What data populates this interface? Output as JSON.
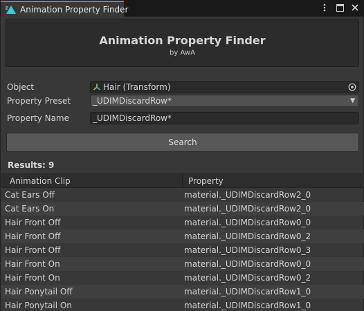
{
  "window": {
    "tab_title": "Animation Property Finder",
    "controls": [
      "more-options",
      "maximize",
      "close"
    ]
  },
  "header": {
    "title": "Animation Property Finder",
    "subtitle": "by AwA"
  },
  "form": {
    "object": {
      "label": "Object",
      "value": "Hair (Transform)"
    },
    "preset": {
      "label": "Property Preset",
      "value": "_UDIMDiscardRow*"
    },
    "name": {
      "label": "Property Name",
      "value": "_UDIMDiscardRow*"
    }
  },
  "search_label": "Search",
  "results": {
    "label": "Results: 9",
    "columns": [
      "Animation Clip",
      "Property"
    ],
    "rows": [
      {
        "clip": "Cat Ears Off",
        "property": "material._UDIMDiscardRow2_0"
      },
      {
        "clip": "Cat Ears On",
        "property": "material._UDIMDiscardRow2_0"
      },
      {
        "clip": "Hair Front Off",
        "property": "material._UDIMDiscardRow0_0"
      },
      {
        "clip": "Hair Front Off",
        "property": "material._UDIMDiscardRow0_2"
      },
      {
        "clip": "Hair Front Off",
        "property": "material._UDIMDiscardRow0_3"
      },
      {
        "clip": "Hair Front On",
        "property": "material._UDIMDiscardRow0_0"
      },
      {
        "clip": "Hair Front On",
        "property": "material._UDIMDiscardRow0_2"
      },
      {
        "clip": "Hair Ponytail Off",
        "property": "material._UDIMDiscardRow1_0"
      },
      {
        "clip": "Hair Ponytail On",
        "property": "material._UDIMDiscardRow1_0"
      }
    ]
  },
  "colors": {
    "accent": "#4d8fd6",
    "panel": "#383838",
    "field": "#2a2a2a",
    "button": "#585858"
  }
}
